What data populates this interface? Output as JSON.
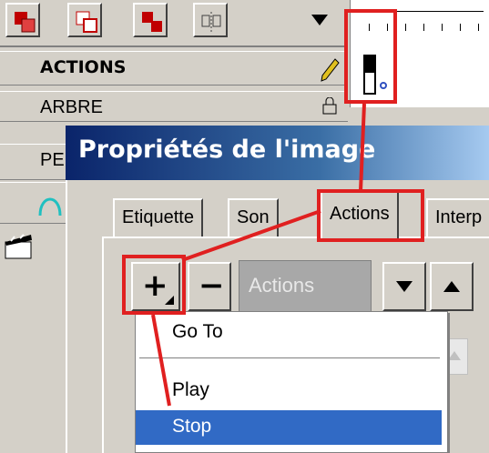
{
  "layers": [
    {
      "label": "ACTIONS",
      "bold": true
    },
    {
      "label": "ARBRE",
      "bold": false
    },
    {
      "label": "PE",
      "bold": false
    }
  ],
  "dialog": {
    "title": "Propriétés de l'image",
    "tabs": [
      "Etiquette",
      "Son",
      "Actions",
      "Interp"
    ],
    "active_tab": "Actions",
    "add_button": "+",
    "remove_button": "−",
    "actions_combo": "Actions"
  },
  "menu": {
    "items": [
      "Go To",
      "Play",
      "Stop"
    ],
    "selected": "Stop"
  },
  "colors": {
    "highlight": "#e02020",
    "title_bar": "#0a246a",
    "selection": "#316ac5",
    "window": "#d4d0c8"
  }
}
